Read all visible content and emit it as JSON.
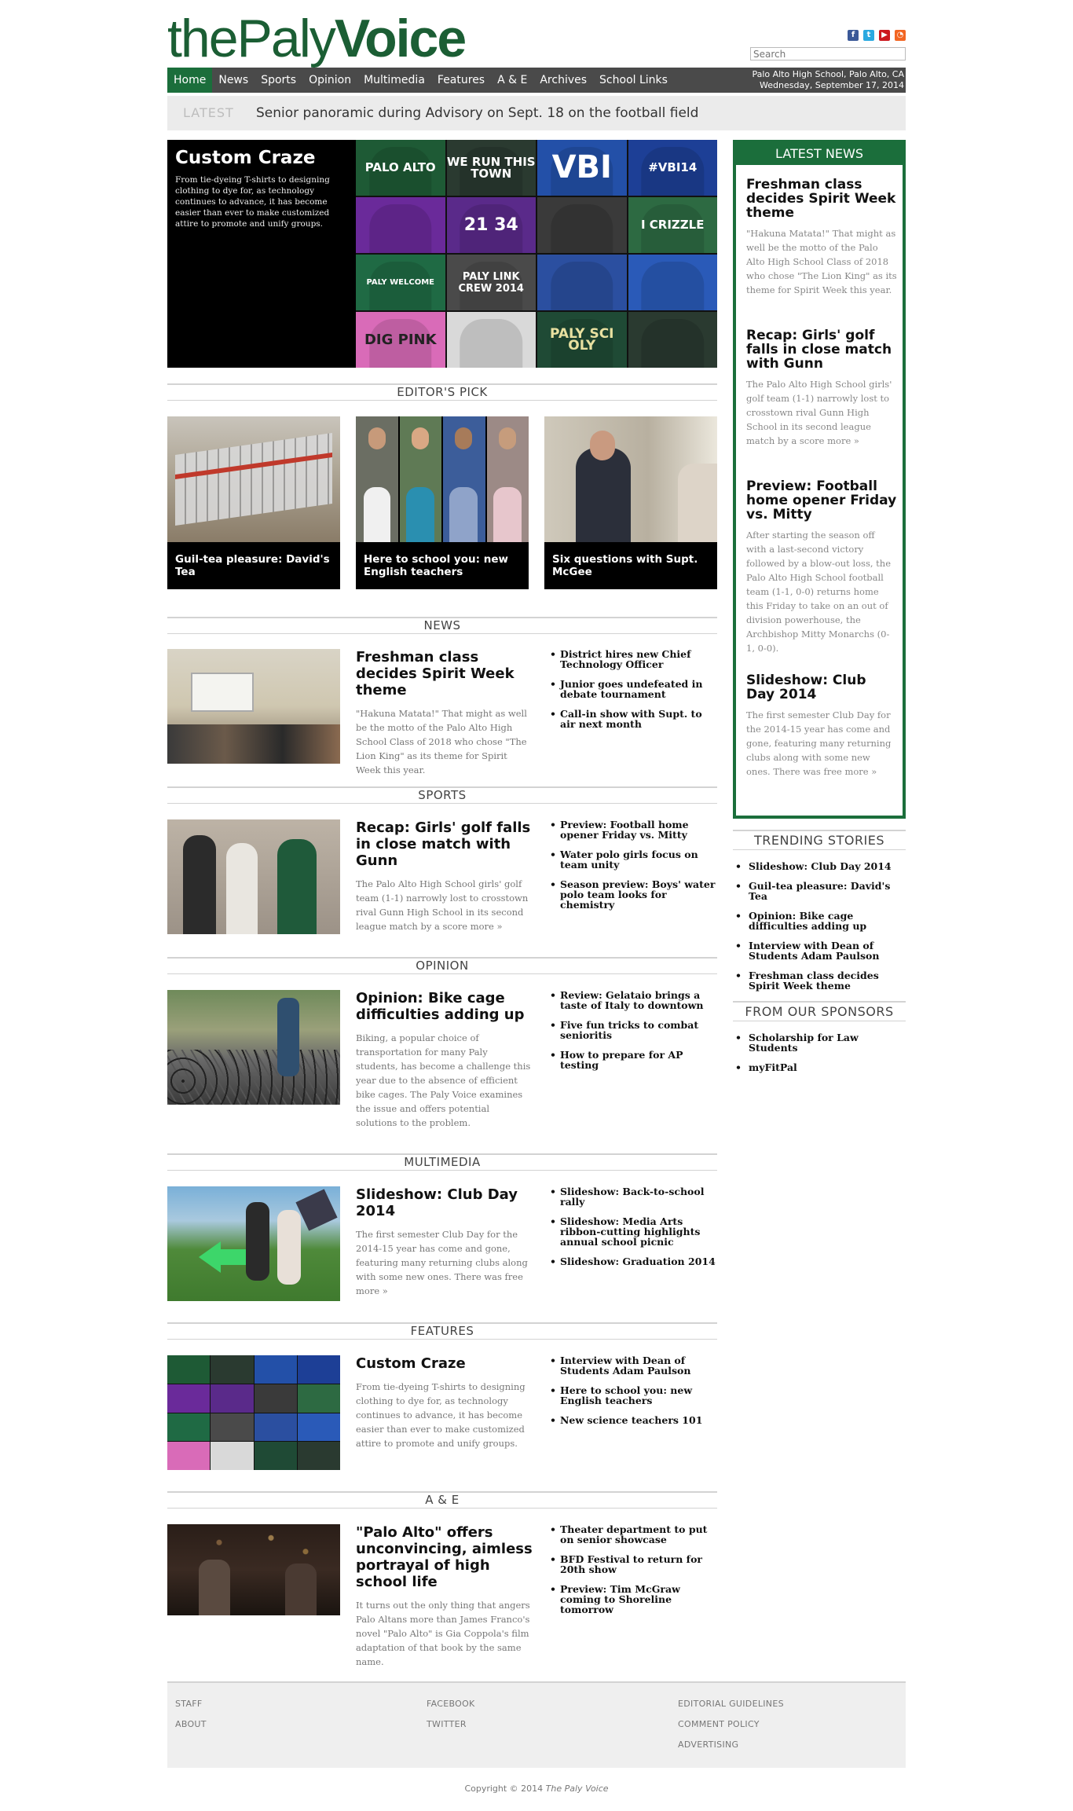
{
  "header": {
    "logo": {
      "part1": "the",
      "part2": "Paly",
      "part3": "Voice"
    },
    "search_placeholder": "Search",
    "social": [
      "facebook-icon",
      "twitter-icon",
      "youtube-icon",
      "rss-icon"
    ],
    "location": "Palo Alto High School, Palo Alto, CA",
    "date": "Wednesday, September 17, 2014"
  },
  "nav": [
    "Home",
    "News",
    "Sports",
    "Opinion",
    "Multimedia",
    "Features",
    "A & E",
    "Archives",
    "School Links"
  ],
  "latest": {
    "label": "LATEST",
    "text": "Senior panoramic during Advisory on Sept. 18 on the football field"
  },
  "feature": {
    "title": "Custom Craze",
    "summary": "From tie-dyeing T-shirts to designing clothing to dye for, as technology continues to advance, it has become easier than ever to make customized attire to promote and unify groups.",
    "shirt_texts": [
      "PALO ALTO",
      "WE RUN THIS TOWN",
      "VBI",
      "#VBI14",
      "",
      "21 34",
      "",
      "I CRIZZLE",
      "PALY WELCOME",
      "PALY LINK CREW 2014",
      "",
      "",
      "DIG PINK",
      "",
      "PALY SCI OLY",
      ""
    ]
  },
  "editors_pick": {
    "heading": "EDITOR'S PICK",
    "items": [
      {
        "caption": "Guil-tea pleasure: David's Tea"
      },
      {
        "caption": "Here to school you: new English teachers"
      },
      {
        "caption": "Six questions with Supt. McGee"
      }
    ]
  },
  "sections": [
    {
      "heading": "NEWS",
      "title": "Freshman class decides Spirit Week theme",
      "summary": "\"Hakuna Matata!\" That might as well be the motto of the Palo Alto High School Class of 2018 who chose \"The Lion King\" as its theme for Spirit Week this year.",
      "links": [
        "District hires new Chief Technology Officer",
        "Junior goes undefeated in debate tournament",
        "Call-in show with Supt. to air next month"
      ]
    },
    {
      "heading": "SPORTS",
      "title": "Recap: Girls' golf falls in close match with Gunn",
      "summary": "The Palo Alto High School girls' golf team (1-1) narrowly lost to crosstown rival Gunn High School in its second league match by a score more »",
      "links": [
        "Preview: Football home opener Friday vs. Mitty",
        "Water polo girls focus on team unity",
        "Season preview: Boys' water polo team looks for chemistry"
      ]
    },
    {
      "heading": "OPINION",
      "title": "Opinion: Bike cage difficulties adding up",
      "summary": "Biking, a popular choice of transportation for many Paly students, has become a challenge this year due to the absence of efficient bike cages. The Paly Voice examines the issue and offers potential solutions to the problem.",
      "links": [
        "Review: Gelataio brings a taste of Italy to downtown",
        "Five fun tricks to combat senioritis",
        "How to prepare for AP testing"
      ]
    },
    {
      "heading": "MULTIMEDIA",
      "title": "Slideshow: Club Day 2014",
      "summary": "The first semester Club Day for the 2014-15 year has come and gone, featuring many returning clubs along with some new ones. There was free more »",
      "links": [
        "Slideshow: Back-to-school rally",
        "Slideshow: Media Arts ribbon-cutting highlights annual school picnic",
        "Slideshow: Graduation 2014"
      ]
    },
    {
      "heading": "FEATURES",
      "title": "Custom Craze",
      "summary": "From tie-dyeing T-shirts to designing clothing to dye for, as technology continues to advance, it has become easier than ever to make customized attire to promote and unify groups.",
      "links": [
        "Interview with Dean of Students Adam Paulson",
        "Here to school you: new English teachers",
        "New science teachers 101"
      ]
    },
    {
      "heading": "A & E",
      "title": "\"Palo Alto\" offers unconvincing, aimless portrayal of high school life",
      "summary": "It turns out the only thing that angers Palo Altans more than James Franco's novel \"Palo Alto\" is Gia Coppola's film adaptation of that book by the same name.",
      "links": [
        "Theater department to put on senior showcase",
        "BFD Festival to return for 20th show",
        "Preview: Tim McGraw coming to Shoreline tomorrow"
      ]
    }
  ],
  "latest_news": {
    "heading": "LATEST NEWS",
    "items": [
      {
        "title": "Freshman class decides Spirit Week theme",
        "summary": "\"Hakuna Matata!\" That might as well be the motto of the Palo Alto High School Class of 2018 who chose \"The Lion King\" as its theme for Spirit Week this year."
      },
      {
        "title": "Recap: Girls' golf falls in close match with Gunn",
        "summary": "The Palo Alto High School girls' golf team (1-1) narrowly lost to crosstown rival Gunn High School in its second league match by a score more »"
      },
      {
        "title": "Preview: Football home opener Friday vs. Mitty",
        "summary": "After starting the season off with a last-second victory followed by a blow-out loss, the Palo Alto High School football team (1-1, 0-0) returns home this Friday to take on an out of division powerhouse, the Archbishop Mitty Monarchs (0-1, 0-0)."
      },
      {
        "title": "Slideshow: Club Day 2014",
        "summary": "The first semester Club Day for the 2014-15 year has come and gone, featuring many returning clubs along with some new ones. There was free more »"
      }
    ]
  },
  "trending": {
    "heading": "TRENDING STORIES",
    "items": [
      "Slideshow: Club Day 2014",
      "Guil-tea pleasure: David's Tea",
      "Opinion: Bike cage difficulties adding up",
      "Interview with Dean of Students Adam Paulson",
      "Freshman class decides Spirit Week theme"
    ]
  },
  "sponsors": {
    "heading": "FROM OUR SPONSORS",
    "items": [
      "Scholarship for Law Students",
      "myFitPal"
    ]
  },
  "footer": {
    "col1": [
      "STAFF",
      "ABOUT"
    ],
    "col2": [
      "FACEBOOK",
      "TWITTER"
    ],
    "col3": [
      "EDITORIAL GUIDELINES",
      "COMMENT POLICY",
      "ADVERTISING"
    ],
    "copyright_prefix": "Copyright © 2014 ",
    "copyright_name": "The Paly Voice"
  },
  "colors": {
    "brand_green": "#1b6e3b",
    "nav_bg": "#4a4a4a"
  }
}
